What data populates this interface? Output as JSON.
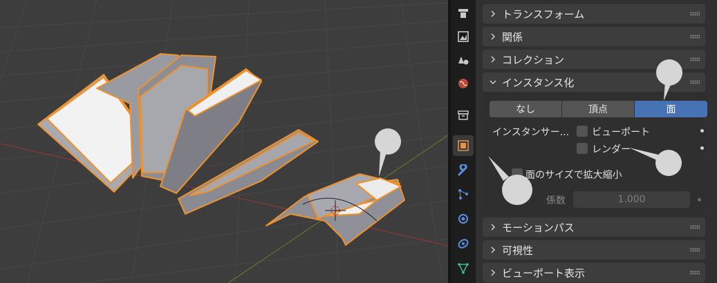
{
  "tabs": [
    {
      "icon": "tool-icon"
    },
    {
      "icon": "render-icon"
    },
    {
      "icon": "output-icon"
    },
    {
      "icon": "view-layer-icon"
    },
    {
      "icon": "scene-icon"
    },
    {
      "icon": "world-icon"
    },
    {
      "icon": "collection-icon"
    },
    {
      "icon": "object-icon",
      "active": true
    },
    {
      "icon": "modifier-wrench-icon"
    },
    {
      "icon": "particles-icon"
    },
    {
      "icon": "physics-icon"
    },
    {
      "icon": "constraints-icon"
    },
    {
      "icon": "object-data-icon"
    }
  ],
  "panels": {
    "transform": "トランスフォーム",
    "relations": "関係",
    "collections": "コレクション",
    "instancing": "インスタンス化",
    "motion_paths": "モーションパス",
    "visibility": "可視性",
    "viewport_display": "ビューポート表示"
  },
  "instancing": {
    "options": [
      "なし",
      "頂点",
      "面"
    ],
    "selected": "面",
    "instancer_label": "インスタンサー...",
    "viewport_label": "ビューポート",
    "render_label": "レンダー",
    "scale_by_face_label": "面のサイズで拡大縮小",
    "factor_label": "係数",
    "factor_value": "1.000"
  },
  "colors": {
    "accent": "#4772b3",
    "selection_outline": "#f0922b"
  }
}
